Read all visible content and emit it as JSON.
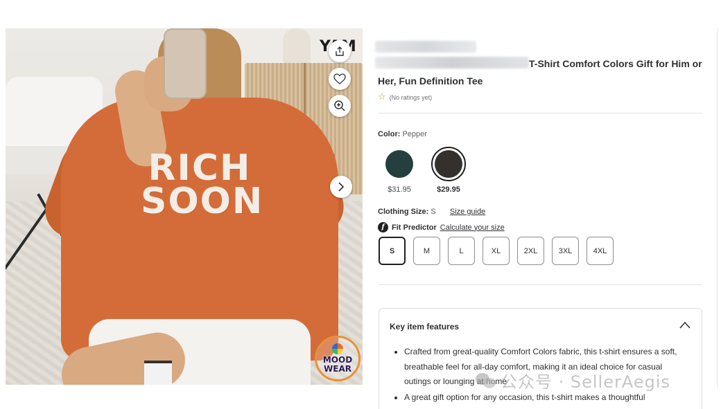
{
  "image": {
    "print_lines": [
      "RICH",
      "SOON"
    ],
    "brand_mark": "YAM",
    "logo_lines": [
      "MOOD",
      "WEAR"
    ],
    "buttons": {
      "share": "share-icon",
      "favorite": "heart-icon",
      "zoom": "zoom-in-icon",
      "next": "chevron-right-icon"
    }
  },
  "product": {
    "title": "T-Shirt Comfort Colors Gift for Him or Her, Fun Definition Tee",
    "rating_text": "(No ratings yet)",
    "color_label": "Color:",
    "color_value": "Pepper",
    "swatches": [
      {
        "color": "#243f3d",
        "price": "$31.95",
        "selected": false
      },
      {
        "color": "#34302c",
        "price": "$29.95",
        "selected": true
      }
    ],
    "size_label": "Clothing Size:",
    "size_value": "S",
    "size_guide": "Size guide",
    "fit_predictor": "Fit Predictor",
    "calculate_size": "Calculate your size",
    "sizes": [
      "S",
      "M",
      "L",
      "XL",
      "2XL",
      "3XL",
      "4XL"
    ],
    "selected_size": "S"
  },
  "features": {
    "heading": "Key item features",
    "bullets": [
      "Crafted from great-quality Comfort Colors fabric, this t-shirt ensures a soft, breathable feel for all-day comfort, making it an ideal choice for casual outings or lounging at home",
      "A great gift option for any occasion, this t-shirt makes a thoughtful"
    ]
  },
  "watermark": {
    "text": "公众号 · SellerAegis"
  },
  "colors": {
    "accent_star": "#c19a2b",
    "text": "#2e2f32"
  }
}
